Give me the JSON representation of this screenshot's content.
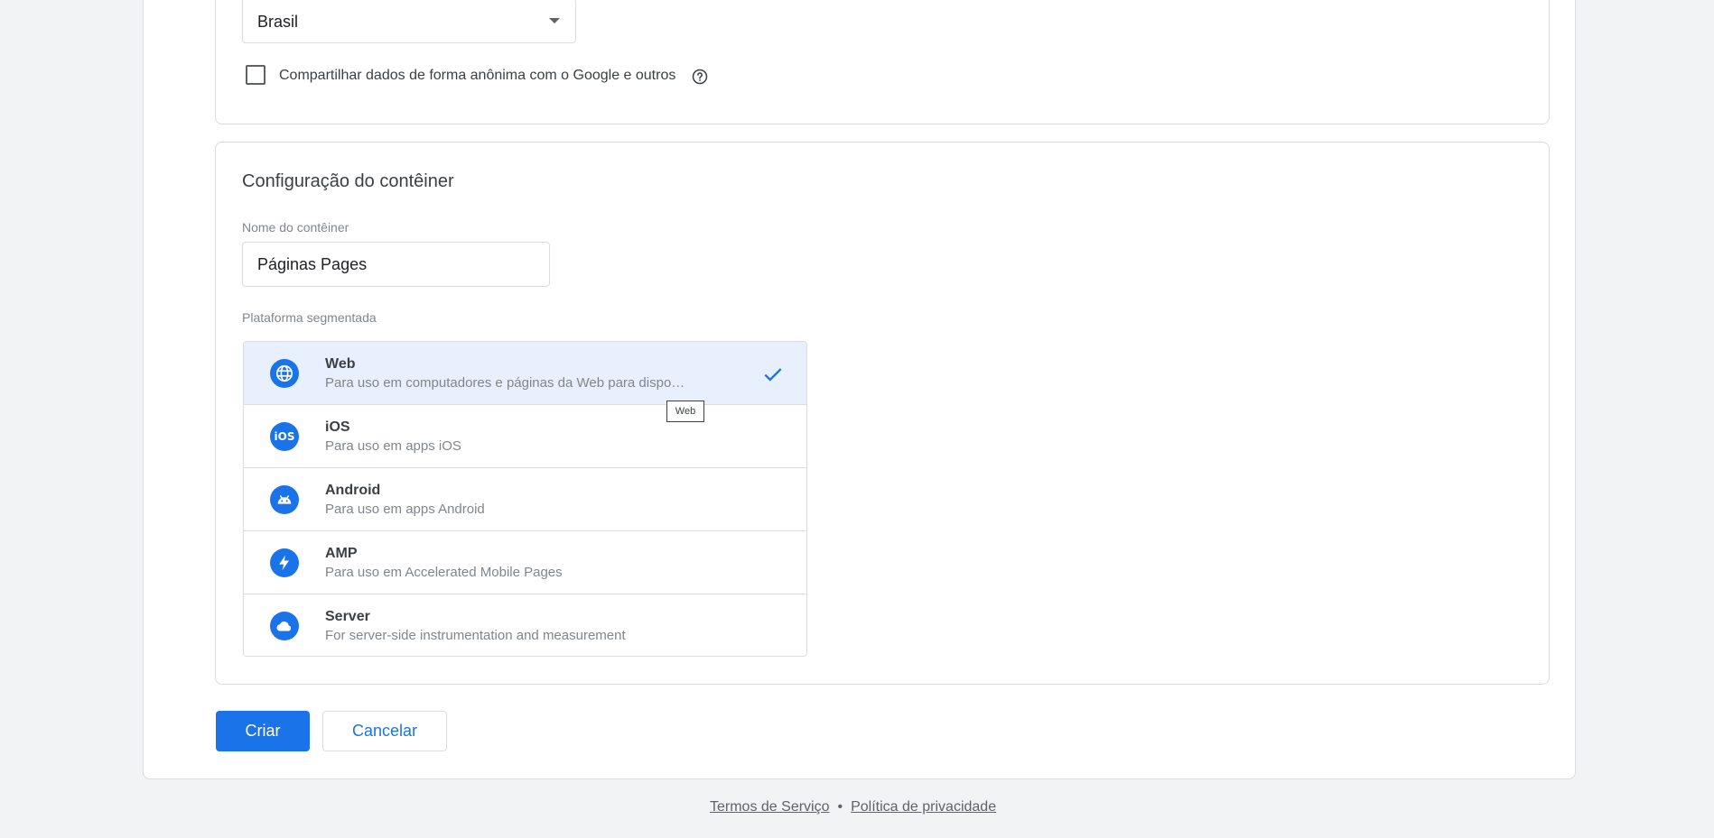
{
  "country_select": {
    "value": "Brasil"
  },
  "share_checkbox": {
    "label": "Compartilhar dados de forma anônima com o Google e outros",
    "checked": false
  },
  "container": {
    "title": "Configuração do contêiner",
    "name_label": "Nome do contêiner",
    "name_value": "Páginas Pages",
    "platform_label": "Plataforma segmentada",
    "platforms": [
      {
        "title": "Web",
        "desc": "Para uso em computadores e páginas da Web para dispositivos móveis",
        "icon": "globe-icon",
        "selected": true
      },
      {
        "title": "iOS",
        "desc": "Para uso em apps iOS",
        "icon": "ios-icon",
        "selected": false
      },
      {
        "title": "Android",
        "desc": "Para uso em apps Android",
        "icon": "android-icon",
        "selected": false
      },
      {
        "title": "AMP",
        "desc": "Para uso em Accelerated Mobile Pages",
        "icon": "lightning-icon",
        "selected": false
      },
      {
        "title": "Server",
        "desc": "For server-side instrumentation and measurement",
        "icon": "cloud-icon",
        "selected": false
      }
    ],
    "tooltip": "Web"
  },
  "actions": {
    "create_label": "Criar",
    "cancel_label": "Cancelar"
  },
  "footer": {
    "terms": "Termos de Serviço",
    "separator": "•",
    "privacy": "Política de privacidade"
  },
  "colors": {
    "accent": "#1a73e8",
    "selected_bg": "#e8f0fe",
    "page_bg": "#f1f3f4"
  }
}
